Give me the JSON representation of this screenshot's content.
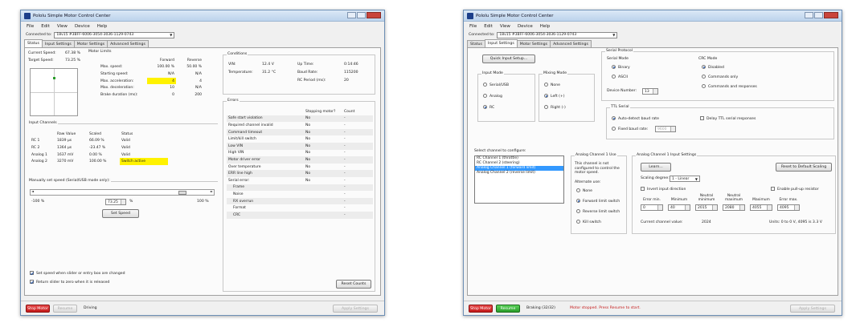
{
  "left": {
    "title": "Pololu Simple Motor Control Center",
    "menu": [
      "File",
      "Edit",
      "View",
      "Device",
      "Help"
    ],
    "connected_label": "Connected to:",
    "device": "18v15 #3BFF-6006-3054-3036-1129-0743",
    "tabs": [
      "Status",
      "Input Settings",
      "Motor Settings",
      "Advanced Settings"
    ],
    "current_speed_label": "Current Speed:",
    "current_speed": "67.38 %",
    "target_speed_label": "Target Speed:",
    "target_speed": "73.25 %",
    "motor_limits": {
      "title": "Motor Limits",
      "headers": [
        "",
        "Forward",
        "Reverse"
      ],
      "rows": [
        [
          "Max. speed:",
          "100.00 %",
          "50.00 %"
        ],
        [
          "Starting speed:",
          "N/A",
          "N/A"
        ],
        [
          "Max. acceleration:",
          "4",
          "4"
        ],
        [
          "Max. deceleration:",
          "10",
          "N/A"
        ],
        [
          "Brake duration (ms):",
          "0",
          "200"
        ]
      ]
    },
    "conditions": {
      "title": "Conditions",
      "vin_label": "VIN:",
      "vin": "12.4 V",
      "temp_label": "Temperature:",
      "temp": "31.2 °C",
      "uptime_label": "Up Time:",
      "uptime": "0:14:46",
      "baud_label": "Baud Rate:",
      "baud": "115200",
      "rc_label": "RC Period (ms):",
      "rc": "20"
    },
    "errors": {
      "title": "Errors",
      "col1": "Stopping motor?",
      "col2": "Count",
      "rows": [
        [
          "Safe start violation",
          "No",
          "-"
        ],
        [
          "Required channel invalid",
          "No",
          "-"
        ],
        [
          "Command timeout",
          "No",
          "-"
        ],
        [
          "Limit/kill switch",
          "No",
          "-"
        ],
        [
          "Low VIN",
          "No",
          "-"
        ],
        [
          "High VIN",
          "No",
          "-"
        ],
        [
          "Motor driver error",
          "No",
          "-"
        ],
        [
          "Over temperature",
          "No",
          "-"
        ],
        [
          "ERR line high",
          "No",
          "-"
        ],
        [
          "Serial error:",
          "No",
          "-"
        ],
        [
          "Frame",
          "",
          "-"
        ],
        [
          "Noise",
          "",
          "-"
        ],
        [
          "RX overrun",
          "",
          "-"
        ],
        [
          "Format",
          "",
          "-"
        ],
        [
          "CRC",
          "",
          "-"
        ]
      ],
      "reset_label": "Reset Counts"
    },
    "input_channels": {
      "title": "Input Channels",
      "headers": [
        "",
        "Raw Value",
        "Scaled",
        "Status"
      ],
      "rows": [
        [
          "RC 1",
          "1839 µs",
          "66.09 %",
          "Valid"
        ],
        [
          "RC 2",
          "1364 µs",
          "-23.47 %",
          "Valid"
        ],
        [
          "Analog 1",
          "1637 mV",
          "0.00 %",
          "Valid"
        ],
        [
          "Analog 2",
          "3270 mV",
          "100.00 %",
          "Switch active"
        ]
      ]
    },
    "manual": {
      "title": "Manually set speed (Serial/USB mode only):",
      "min": "-100 %",
      "max": "100 %",
      "value": "73.25",
      "unit": "%",
      "slider_fraction": 0.866,
      "set_speed": "Set Speed",
      "chk1": "Set speed when slider or entry box are changed",
      "chk2": "Return slider to zero when it is released"
    },
    "bottom": {
      "stop": "Stop Motor",
      "resume": "Resume",
      "status": "Driving",
      "apply": "Apply Settings"
    }
  },
  "right": {
    "title": "Pololu Simple Motor Control Center",
    "menu": [
      "File",
      "Edit",
      "View",
      "Device",
      "Help"
    ],
    "connected_label": "Connected to:",
    "device": "18v15 #3BFF-6006-3054-3036-1129-0743",
    "tabs": [
      "Status",
      "Input Settings",
      "Motor Settings",
      "Advanced Settings"
    ],
    "quick_setup": "Quick Input Setup...",
    "input_mode": {
      "title": "Input Mode",
      "options": [
        "Serial/USB",
        "Analog",
        "RC"
      ],
      "selected": 2
    },
    "mixing_mode": {
      "title": "Mixing Mode",
      "options": [
        "None",
        "Left (+)",
        "Right (-)"
      ],
      "selected": 1
    },
    "serial_protocol": "Serial Protocol",
    "serial_mode": {
      "title": "Serial Mode",
      "options": [
        "Binary",
        "ASCII"
      ],
      "selected": 0
    },
    "crc_mode": {
      "title": "CRC Mode",
      "options": [
        "Disabled",
        "Commands only",
        "Commands and responses"
      ],
      "selected": 0
    },
    "device_number_label": "Device Number:",
    "device_number": "13",
    "ttl_serial": "TTL Serial",
    "auto_baud": "Auto-detect baud rate",
    "fixed_baud": "Fixed baud rate:",
    "fixed_baud_value": "9600",
    "delay_ttl": "Delay TTL serial responses",
    "select_channel": "Select channel to configure:",
    "channels": [
      "RC Channel 1 (throttle)",
      "RC Channel 2 (steering)",
      "Analog Channel 1 (forward limit)",
      "Analog Channel 2 (reverse limit)"
    ],
    "selected_channel": 2,
    "use": {
      "title": "Analog Channel 1 Use",
      "note": "This channel is not configured to control the motor speed.",
      "alt_label": "Alternate use:",
      "options": [
        "None",
        "Forward limit switch",
        "Reverse limit switch",
        "Kill switch"
      ],
      "selected": 1
    },
    "input_settings": {
      "title": "Analog Channel 1 Input Settings",
      "learn": "Learn...",
      "reset": "Reset to Default Scaling",
      "scaling_label": "Scaling degree:",
      "scaling_value": "1 - Linear",
      "invert": "Invert input direction",
      "pullup": "Enable pull-up resistor",
      "headers": [
        "Error min.",
        "Minimum",
        "Neutral minimum",
        "Neutral maximum",
        "Maximum",
        "Error max."
      ],
      "values": [
        "0",
        "40",
        "2015",
        "2080",
        "4055",
        "4095"
      ],
      "current_label": "Current channel value:",
      "current_value": "2024",
      "units": "Units: 0 to 0 V, 4095 is 3.3 V"
    },
    "bottom": {
      "stop": "Stop Motor",
      "resume": "Resume",
      "status1": "Braking (32/32)",
      "status2": "Motor stopped.  Press Resume to start.",
      "apply": "Apply Settings"
    }
  }
}
